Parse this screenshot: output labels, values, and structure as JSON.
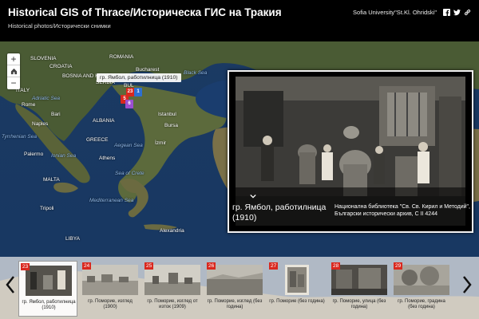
{
  "header": {
    "title": "Historical GIS of Thrace/Историческа ГИС на Тракия",
    "subtitle": "Historical photos/Исторически снимки",
    "university": "Sofia University\"St.Kl. Ohridski\"",
    "share_icons": [
      "facebook-icon",
      "twitter-icon",
      "link-icon"
    ]
  },
  "map": {
    "labels": {
      "slovenia": "SLOVENIA",
      "croatia": "CROATIA",
      "bosnia": "BOSNIA AND HERZEGOVINA",
      "serbia": "SERBIA",
      "romania": "ROMANIA",
      "bucharest": "Bucharest",
      "black_sea": "Black Sea",
      "bulgaria": "BUL",
      "adriatic": "Adriatic Sea",
      "rome": "Rome",
      "albania": "ALBANIA",
      "bari": "Bari",
      "naples": "Naples",
      "tyrrhenian": "Tyrrhenian Sea",
      "italy": "ITALY",
      "palermo": "Palermo",
      "greece": "GREECE",
      "athens": "Athens",
      "ionian": "Ionian Sea",
      "aegean": "Aegean Sea",
      "istanbul": "Istanbul",
      "bursa": "Bursa",
      "izmir": "İzmir",
      "sea_of_crete": "Sea of Crete",
      "malta": "MALTA",
      "mediterranean": "Mediterranean Sea",
      "tripoli": "Tripoli",
      "libya": "LIBYA",
      "alexandria": "Alexandria"
    },
    "zoom_in": "+",
    "zoom_out": "−",
    "home_icon": "home-icon",
    "tooltip": "гр. Ямбол, работилница (1910)"
  },
  "markers": [
    {
      "num": "23",
      "color": "#d9281e"
    },
    {
      "num": "1",
      "color": "#2e6fd1"
    },
    {
      "num": "5",
      "color": "#d9281e"
    },
    {
      "num": "6",
      "color": "#9b4fd1"
    }
  ],
  "popup": {
    "title": "гр. Ямбол, работилница (1910)",
    "source": "Национална библиотека \"Св. Св. Кирил и Методий\", Български исторически архив, С II 4244"
  },
  "thumbnails": [
    {
      "num": "23",
      "caption": "гр. Ямбол, работилница (1910)"
    },
    {
      "num": "24",
      "caption": "гр. Поморие, изглед (1900)"
    },
    {
      "num": "25",
      "caption": "гр. Поморие, изглед от изток (1909)"
    },
    {
      "num": "26",
      "caption": "гр. Поморие, изглед (без година)"
    },
    {
      "num": "27",
      "caption": "гр. Поморие (без година)"
    },
    {
      "num": "28",
      "caption": "гр. Поморие, улица (без година)"
    },
    {
      "num": "29",
      "caption": "гр. Поморие, градина (без година)"
    }
  ],
  "colors": {
    "accent_red": "#d9281e",
    "header_bg": "#000000",
    "sea": "#1b3a63"
  }
}
